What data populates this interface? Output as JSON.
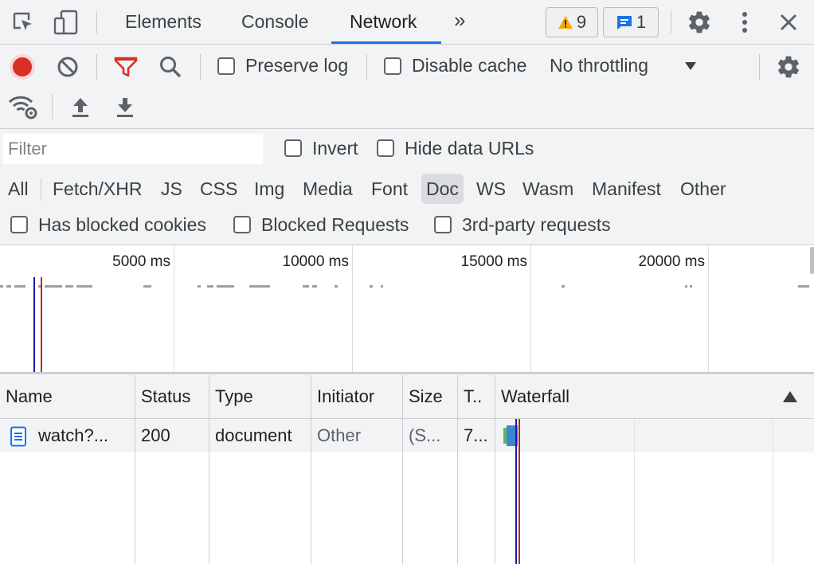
{
  "tabs": {
    "elements": "Elements",
    "console": "Console",
    "network": "Network",
    "more": "»"
  },
  "badges": {
    "warnings_count": "9",
    "messages_count": "1"
  },
  "toolbar": {
    "preserve_log": "Preserve log",
    "disable_cache": "Disable cache",
    "throttling": "No throttling"
  },
  "filter": {
    "placeholder": "Filter",
    "invert": "Invert",
    "hide_data_urls": "Hide data URLs",
    "types": [
      "All",
      "Fetch/XHR",
      "JS",
      "CSS",
      "Img",
      "Media",
      "Font",
      "Doc",
      "WS",
      "Wasm",
      "Manifest",
      "Other"
    ],
    "selected_type": "Doc",
    "has_blocked_cookies": "Has blocked cookies",
    "blocked_requests": "Blocked Requests",
    "third_party": "3rd-party requests"
  },
  "overview": {
    "ticks": [
      "5000 ms",
      "10000 ms",
      "15000 ms",
      "20000 ms"
    ]
  },
  "table": {
    "headers": {
      "name": "Name",
      "status": "Status",
      "type": "Type",
      "initiator": "Initiator",
      "size": "Size",
      "time": "T..",
      "waterfall": "Waterfall"
    },
    "rows": [
      {
        "name": "watch?...",
        "status": "200",
        "type": "document",
        "initiator": "Other",
        "size": "(S...",
        "time": "7..."
      }
    ]
  },
  "colors": {
    "accent": "#1a73e8",
    "record": "#d93025",
    "filter_active": "#d93025",
    "warning": "#f9ab00",
    "domcontentloaded_line": "#1a1aa6",
    "load_line": "#c5221f"
  }
}
